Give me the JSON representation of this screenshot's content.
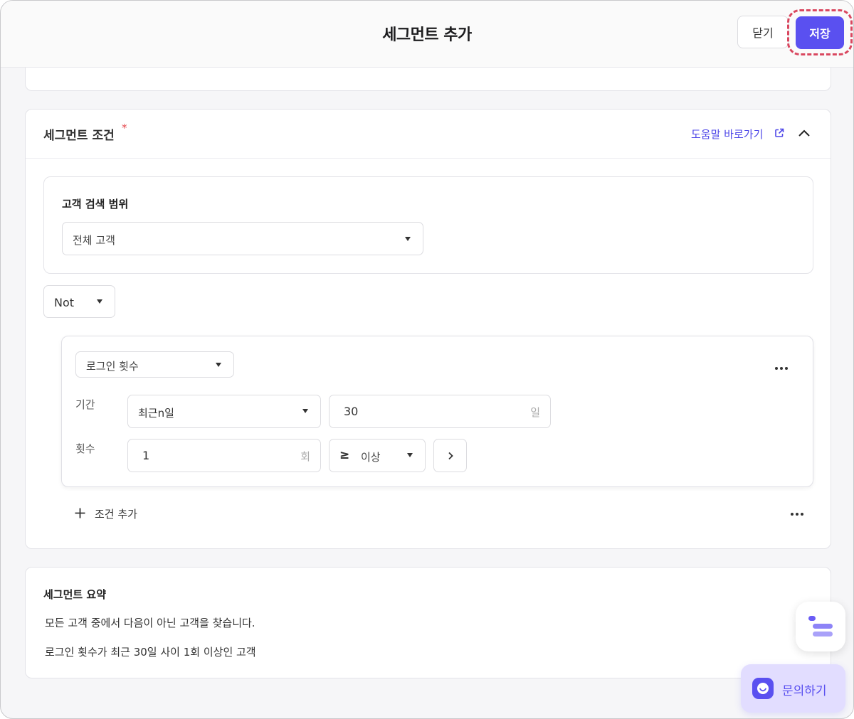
{
  "header": {
    "title": "세그먼트 추가",
    "close_label": "닫기",
    "save_label": "저장"
  },
  "condition": {
    "title": "세그먼트 조건",
    "required_mark": "*",
    "help_link": "도움말 바로가기",
    "scope": {
      "label": "고객 검색 범위",
      "selected": "전체 고객"
    },
    "logic_operator": "Not",
    "rule": {
      "metric": "로그인 횟수",
      "period_label": "기간",
      "period_type": "최근n일",
      "period_value": "30",
      "period_unit": "일",
      "count_label": "횟수",
      "count_value": "1",
      "count_unit": "회",
      "operator_symbol": "≥",
      "operator_label": "이상"
    },
    "add_condition_label": "조건 추가"
  },
  "summary": {
    "title": "세그먼트 요약",
    "line1": "모든 고객 중에서 다음이 아닌 고객을 찾습니다.",
    "line2": "로그인 횟수가 최근 30일 사이 1회 이상인 고객"
  },
  "support": {
    "inquiry_label": "문의하기"
  },
  "colors": {
    "accent": "#5a50f0",
    "highlight": "#d9475f",
    "required": "#e5484d"
  }
}
